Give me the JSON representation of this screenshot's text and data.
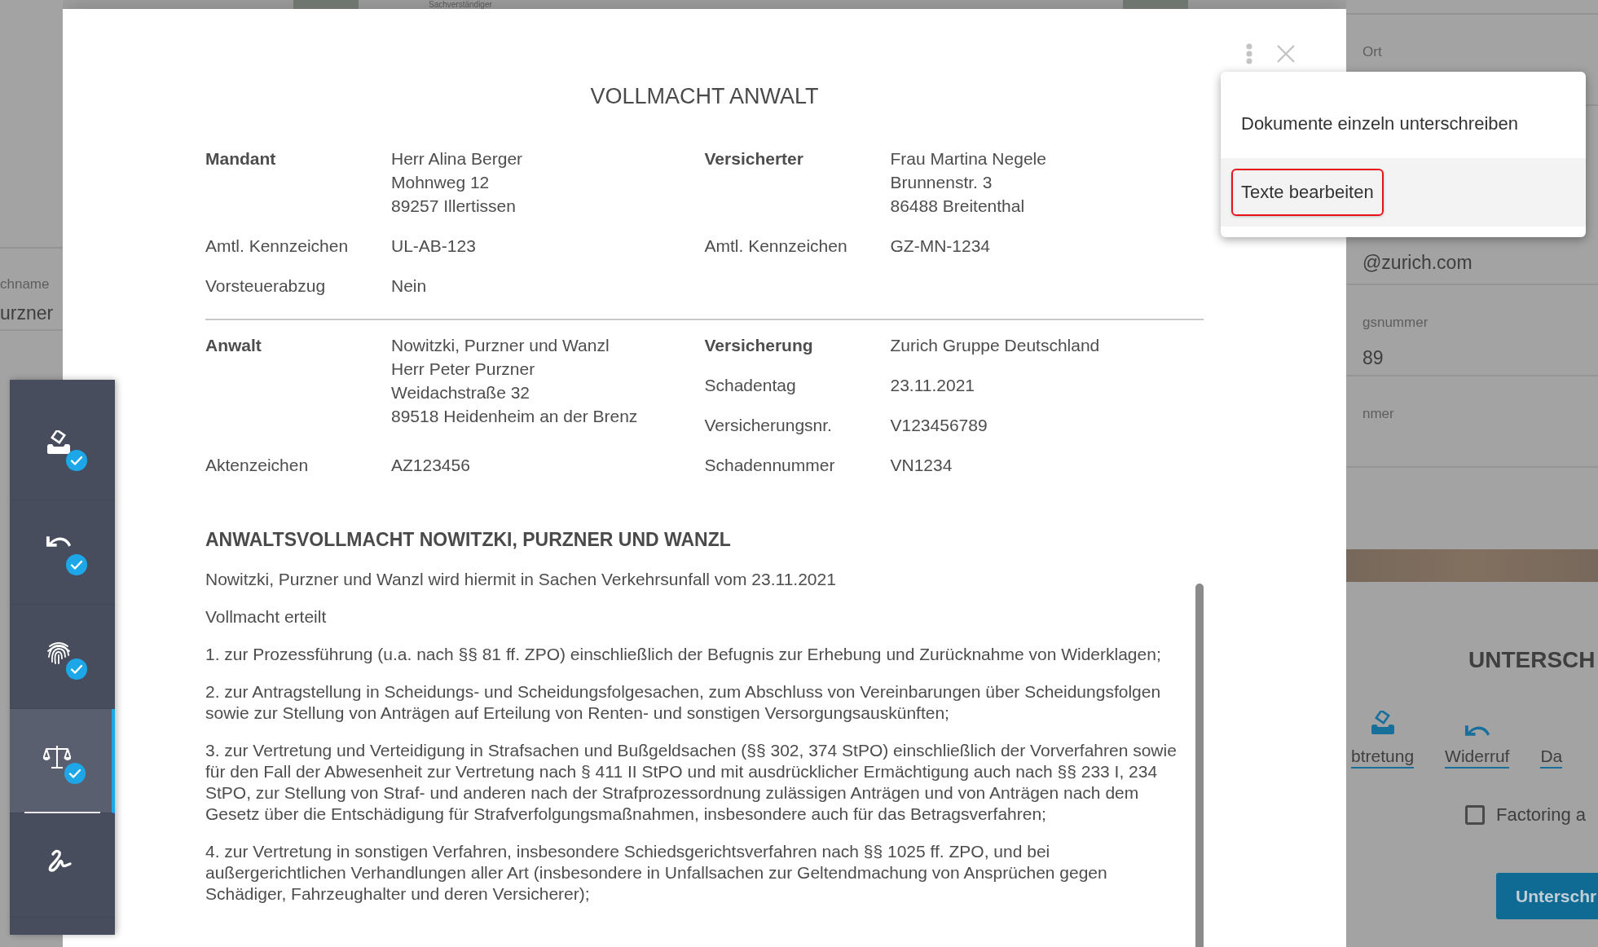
{
  "background": {
    "top_label": "Sachverständiger",
    "left_fields": [
      {
        "label": "chname",
        "value": "urzner"
      }
    ],
    "right_fields": [
      {
        "label": "Ort"
      },
      {
        "value": "@zurich.com"
      },
      {
        "label": "gsnummer",
        "value": "89"
      },
      {
        "label": "nmer"
      }
    ],
    "section_title": "UNTERSCH",
    "doc_links": [
      {
        "label": "btretung",
        "kind": "assignment"
      },
      {
        "label": "Widerruf",
        "kind": "revocation"
      },
      {
        "label": "Da",
        "kind": "none"
      }
    ],
    "checkbox": {
      "label": "Factoring a",
      "checked": false
    },
    "button": "Unterschr"
  },
  "dialog": {
    "title": "VOLLMACHT ANWALT",
    "info_sections": [
      {
        "left": [
          {
            "label": "Mandant",
            "heading": true,
            "lines": [
              "Herr Alina Berger",
              "Mohnweg 12",
              "89257 Illertissen"
            ]
          },
          {
            "label": "Amtl. Kennzeichen",
            "heading": false,
            "lines": [
              "UL-AB-123"
            ]
          },
          {
            "label": "Vorsteuerabzug",
            "heading": false,
            "lines": [
              "Nein"
            ]
          }
        ],
        "right": [
          {
            "label": "Versicherter",
            "heading": true,
            "lines": [
              "Frau Martina Negele",
              "Brunnenstr. 3",
              "86488 Breitenthal"
            ]
          },
          {
            "label": "Amtl. Kennzeichen",
            "heading": false,
            "lines": [
              "GZ-MN-1234"
            ]
          }
        ]
      },
      {
        "left": [
          {
            "label": "Anwalt",
            "heading": true,
            "lines": [
              "Nowitzki, Purzner und Wanzl",
              "Herr Peter Purzner",
              "Weidachstraße 32",
              "89518 Heidenheim an der Brenz"
            ]
          },
          {
            "label": "Aktenzeichen",
            "heading": false,
            "lines": [
              "AZ123456"
            ]
          }
        ],
        "right": [
          {
            "label": "Versicherung",
            "heading": true,
            "lines": [
              "Zurich Gruppe Deutschland"
            ]
          },
          {
            "label": "Schadentag",
            "heading": false,
            "lines": [
              "23.11.2021"
            ]
          },
          {
            "label": "Versicherungsnr.",
            "heading": false,
            "lines": [
              "V123456789"
            ]
          },
          {
            "label": "Schadennummer",
            "heading": false,
            "lines": [
              "VN1234"
            ]
          }
        ]
      }
    ],
    "section_heading": "ANWALTSVOLLMACHT NOWITZKI, PURZNER UND WANZL",
    "paragraphs": [
      "Nowitzki, Purzner und Wanzl wird hiermit in Sachen Verkehrsunfall vom 23.11.2021",
      "Vollmacht erteilt",
      "1. zur Prozessführung (u.a. nach §§ 81 ff. ZPO) einschließlich der Befugnis zur Erhebung und Zurücknahme von Widerklagen;",
      "2. zur Antragstellung in Scheidungs- und Scheidungsfolgesachen, zum Abschluss von Vereinbarungen über Scheidungsfolgen sowie zur Stellung von Anträgen auf Erteilung von Renten- und sonstigen Versorgungsauskünften;",
      "3. zur Vertretung und Verteidigung in Strafsachen und Bußgeldsachen (§§ 302, 374 StPO) einschließlich der Vorverfahren sowie für den Fall der Abwesenheit zur Vertretung nach § 411 II StPO und mit ausdrücklicher Ermächtigung auch nach §§ 233 I, 234 StPO, zur Stellung von Straf- und anderen nach der Strafprozessordnung zulässigen Anträgen und von Anträgen nach dem Gesetz über die Entschädigung für Strafverfolgungsmaßnahmen, insbesondere auch für das Betragsverfahren;",
      "4. zur Vertretung in sonstigen Verfahren, insbesondere Schiedsgerichtsverfahren nach §§ 1025 ff. ZPO, und bei außergerichtlichen Verhandlungen aller Art (insbesondere in Unfallsachen zur Geltendmachung von Ansprüchen gegen Schädiger, Fahrzeughalter und deren Versicherer);"
    ]
  },
  "menu": {
    "items": [
      {
        "label": "Dokumente einzeln unterschreiben",
        "selected": false,
        "outlined": false
      },
      {
        "label": "Texte bearbeiten",
        "selected": true,
        "outlined": true
      }
    ]
  },
  "sidebar": {
    "items": [
      {
        "kind": "assignment",
        "completed": true,
        "selected": false
      },
      {
        "kind": "revocation",
        "completed": true,
        "selected": false
      },
      {
        "kind": "fingerprint",
        "completed": true,
        "selected": false
      },
      {
        "kind": "justice",
        "completed": true,
        "selected": true
      },
      {
        "kind": "signature",
        "completed": false,
        "selected": false
      }
    ]
  }
}
